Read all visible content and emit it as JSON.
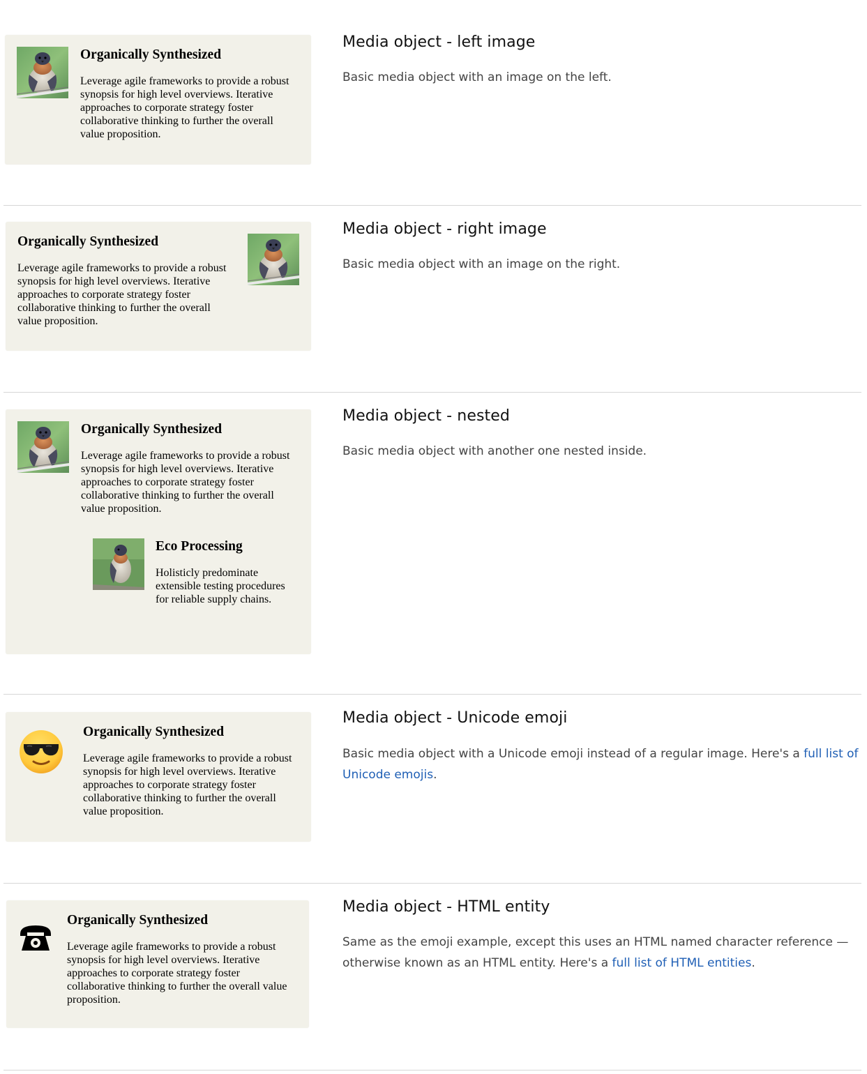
{
  "sections": [
    {
      "card": {
        "title": "Organically Synthesized",
        "body": "Leverage agile frameworks to provide a robust synopsis for high level overviews. Iterative approaches to corporate strategy foster collaborative thinking to further the overall value proposition."
      },
      "heading": "Media object - left image",
      "description": "Basic media object with an image on the left."
    },
    {
      "card": {
        "title": "Organically Synthesized",
        "body": "Leverage agile frameworks to provide a robust synopsis for high level overviews. Iterative approaches to corporate strategy foster collaborative thinking to further the overall value proposition."
      },
      "heading": "Media object - right image",
      "description": "Basic media object with an image on the right."
    },
    {
      "card": {
        "title": "Organically Synthesized",
        "body": "Leverage agile frameworks to provide a robust synopsis for high level overviews. Iterative approaches to corporate strategy foster collaborative thinking to further the overall value proposition.",
        "nested": {
          "title": "Eco Processing",
          "body": "Holisticly predominate extensible testing procedures for reliable supply chains."
        }
      },
      "heading": "Media object - nested",
      "description": "Basic media object with another one nested inside."
    },
    {
      "card": {
        "icon": "sunglasses-emoji",
        "title": "Organically Synthesized",
        "body": "Leverage agile frameworks to provide a robust synopsis for high level overviews. Iterative approaches to corporate strategy foster collaborative thinking to further the overall value proposition."
      },
      "heading": "Media object - Unicode emoji",
      "description_prefix": "Basic media object with a Unicode emoji instead of a regular image. Here's a ",
      "link_text": "full list of Unicode emojis",
      "description_suffix": "."
    },
    {
      "card": {
        "icon": "telephone-icon",
        "title": "Organically Synthesized",
        "body": "Leverage agile frameworks to provide a robust synopsis for high level overviews. Iterative approaches to corporate strategy foster collaborative thinking to further the overall value proposition."
      },
      "heading": "Media object - HTML entity",
      "description_prefix": "Same as the emoji example, except this uses an HTML named character reference — otherwise known as an HTML entity. Here's a ",
      "link_text": "full list of HTML entities",
      "description_suffix": "."
    }
  ],
  "colors": {
    "card_background": "#f2f1e9",
    "link": "#1f5fb5",
    "divider": "#d6d6d6"
  }
}
